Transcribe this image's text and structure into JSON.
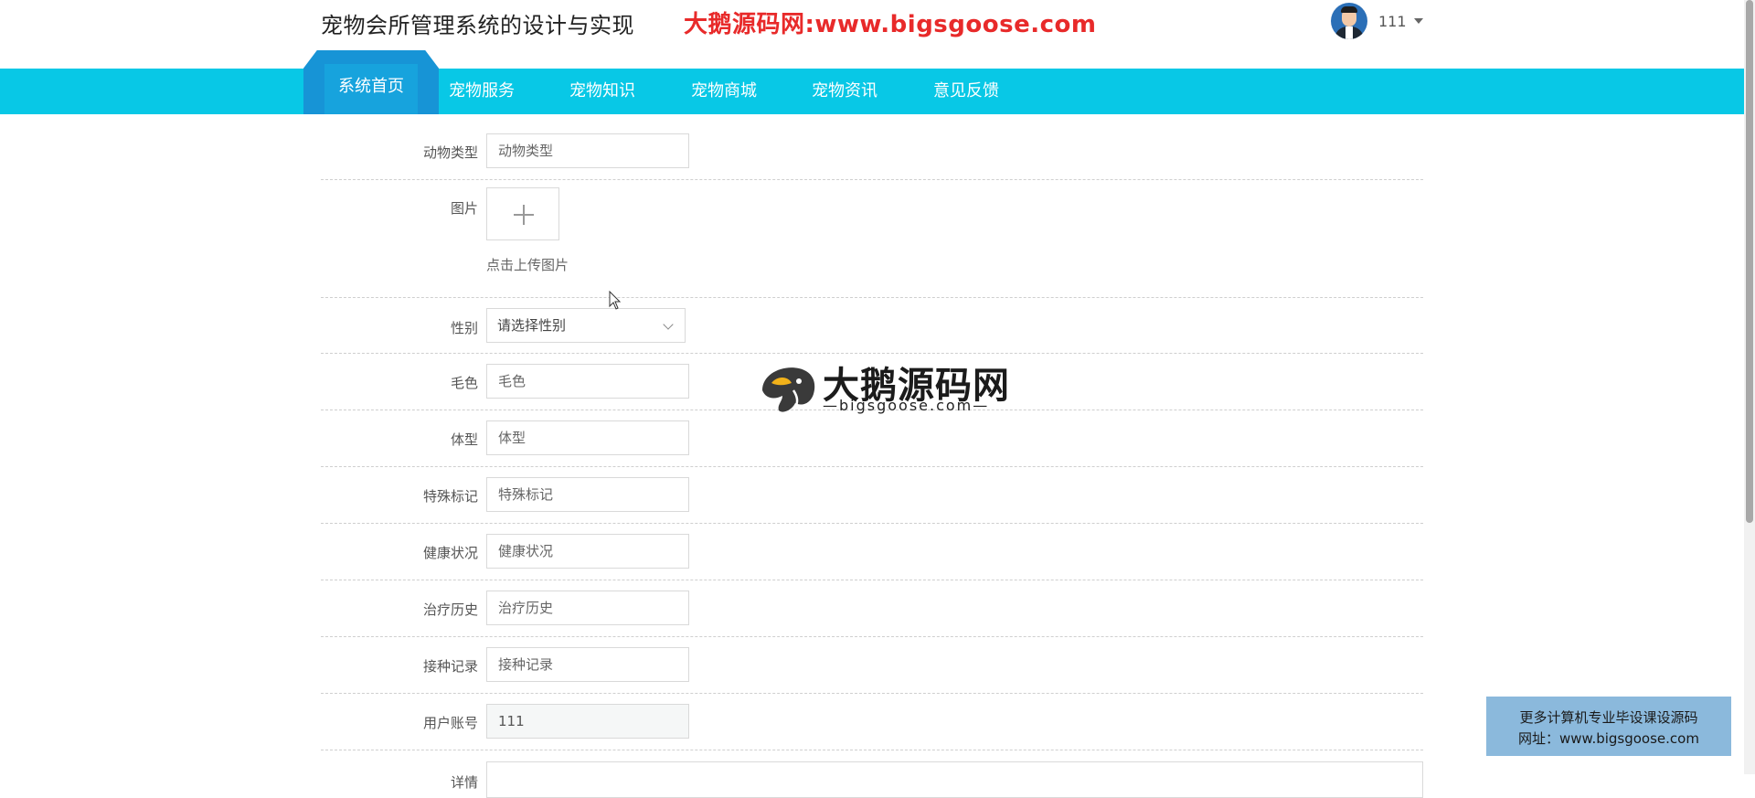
{
  "header": {
    "site_title": "宠物会所管理系统的设计与实现",
    "promo_text": "大鹅源码网:www.bigsgoose.com",
    "username": "111"
  },
  "nav": {
    "items": [
      {
        "label": "系统首页",
        "active": true
      },
      {
        "label": "宠物服务",
        "active": false
      },
      {
        "label": "宠物知识",
        "active": false
      },
      {
        "label": "宠物商城",
        "active": false
      },
      {
        "label": "宠物资讯",
        "active": false
      },
      {
        "label": "意见反馈",
        "active": false
      }
    ]
  },
  "form": {
    "animal_type": {
      "label": "动物类型",
      "placeholder": "动物类型"
    },
    "picture": {
      "label": "图片",
      "hint": "点击上传图片"
    },
    "gender": {
      "label": "性别",
      "placeholder": "请选择性别"
    },
    "fur_color": {
      "label": "毛色",
      "placeholder": "毛色"
    },
    "body_type": {
      "label": "体型",
      "placeholder": "体型"
    },
    "special_marks": {
      "label": "特殊标记",
      "placeholder": "特殊标记"
    },
    "health_status": {
      "label": "健康状况",
      "placeholder": "健康状况"
    },
    "treatment_history": {
      "label": "治疗历史",
      "placeholder": "治疗历史"
    },
    "vaccination_record": {
      "label": "接种记录",
      "placeholder": "接种记录"
    },
    "user_account": {
      "label": "用户账号",
      "value": "111"
    },
    "details": {
      "label": "详情"
    }
  },
  "watermark": {
    "title": "大鹅源码网",
    "subtitle": "—bigsgoose.com—"
  },
  "promo_box": {
    "line1": "更多计算机专业毕设课设源码",
    "line2": "网址：www.bigsgoose.com"
  },
  "colors": {
    "nav_bg": "#08c8e6",
    "nav_active": "#1794d6",
    "promo_red": "#e82a2a",
    "promo_box_bg": "#8bb9dc"
  }
}
